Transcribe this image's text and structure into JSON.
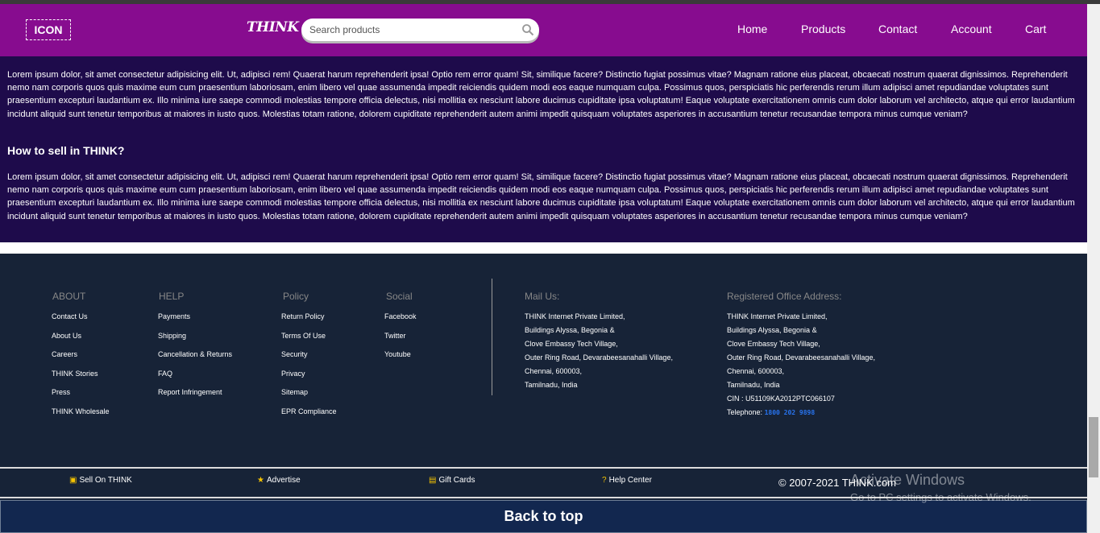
{
  "header": {
    "logo_text": "ICON",
    "brand": "THINK",
    "search_placeholder": "Search products",
    "nav": [
      "Home",
      "Products",
      "Contact",
      "Account",
      "Cart"
    ]
  },
  "content": {
    "para1": "Lorem ipsum dolor, sit amet consectetur adipisicing elit. Ut, adipisci rem! Quaerat harum reprehenderit ipsa! Optio rem error quam! Sit, similique facere? Distinctio fugiat possimus vitae? Magnam ratione eius placeat, obcaecati nostrum quaerat dignissimos. Reprehenderit nemo nam corporis quos quis maxime eum cum praesentium laboriosam, enim libero vel quae assumenda impedit reiciendis quidem modi eos eaque numquam culpa. Possimus quos, perspiciatis hic perferendis rerum illum adipisci amet repudiandae voluptates sunt praesentium excepturi laudantium ex. Illo minima iure saepe commodi molestias tempore officia delectus, nisi mollitia ex nesciunt labore ducimus cupiditate ipsa voluptatum! Eaque voluptate exercitationem omnis cum dolor laborum vel architecto, atque qui error laudantium incidunt aliquid sunt tenetur temporibus at maiores in iusto quos. Molestias totam ratione, dolorem cupiditate reprehenderit autem animi impedit quisquam voluptates asperiores in accusantium tenetur recusandae tempora minus cumque veniam?",
    "heading": "How to sell in THINK?",
    "para2": "Lorem ipsum dolor, sit amet consectetur adipisicing elit. Ut, adipisci rem! Quaerat harum reprehenderit ipsa! Optio rem error quam! Sit, similique facere? Distinctio fugiat possimus vitae? Magnam ratione eius placeat, obcaecati nostrum quaerat dignissimos. Reprehenderit nemo nam corporis quos quis maxime eum cum praesentium laboriosam, enim libero vel quae assumenda impedit reiciendis quidem modi eos eaque numquam culpa. Possimus quos, perspiciatis hic perferendis rerum illum adipisci amet repudiandae voluptates sunt praesentium excepturi laudantium ex. Illo minima iure saepe commodi molestias tempore officia delectus, nisi mollitia ex nesciunt labore ducimus cupiditate ipsa voluptatum! Eaque voluptate exercitationem omnis cum dolor laborum vel architecto, atque qui error laudantium incidunt aliquid sunt tenetur temporibus at maiores in iusto quos. Molestias totam ratione, dolorem cupiditate reprehenderit autem animi impedit quisquam voluptates asperiores in accusantium tenetur recusandae tempora minus cumque veniam?"
  },
  "footer": {
    "columns": [
      {
        "title": "ABOUT",
        "items": [
          "Contact Us",
          "About Us",
          "Careers",
          "THINK Stories",
          "Press",
          "THINK Wholesale"
        ]
      },
      {
        "title": "HELP",
        "items": [
          "Payments",
          "Shipping",
          "Cancellation & Returns",
          "FAQ",
          "Report Infringement"
        ]
      },
      {
        "title": "Policy",
        "items": [
          "Return Policy",
          "Terms Of Use",
          "Security",
          "Privacy",
          "Sitemap",
          "EPR Compliance"
        ]
      },
      {
        "title": "Social",
        "items": [
          "Facebook",
          "Twitter",
          "Youtube"
        ]
      }
    ],
    "mail": {
      "title": "Mail Us:",
      "lines": [
        "THINK Internet Private Limited,",
        "Buildings Alyssa, Begonia &",
        "Clove Embassy Tech Village,",
        "Outer Ring Road, Devarabeesanahalli Village,",
        "Chennai, 600003,",
        "Tamilnadu, India"
      ]
    },
    "office": {
      "title": "Registered Office Address:",
      "lines": [
        "THINK Internet Private Limited,",
        "Buildings Alyssa, Begonia &",
        "Clove Embassy Tech Village,",
        "Outer Ring Road, Devarabeesanahalli Village,",
        "Chennai, 600003,",
        "Tamilnadu, India",
        "CIN : U51109KA2012PTC066107"
      ],
      "telephone_label": "Telephone:",
      "telephone": "1800 202 9898"
    },
    "bottom_links": [
      "Sell On THINK",
      "Advertise",
      "Gift Cards",
      "Help Center"
    ],
    "copyright": "© 2007-2021 THINK.com"
  },
  "back_to_top": "Back to top",
  "watermark": {
    "title": "Activate Windows",
    "subtitle": "Go to PC settings to activate Windows."
  },
  "colors": {
    "navbar": "#870c8f",
    "content_bg": "#1e0b4b",
    "footer_bg": "#172337",
    "back_to_top_bg": "#12274f",
    "phone": "#2874f0"
  }
}
